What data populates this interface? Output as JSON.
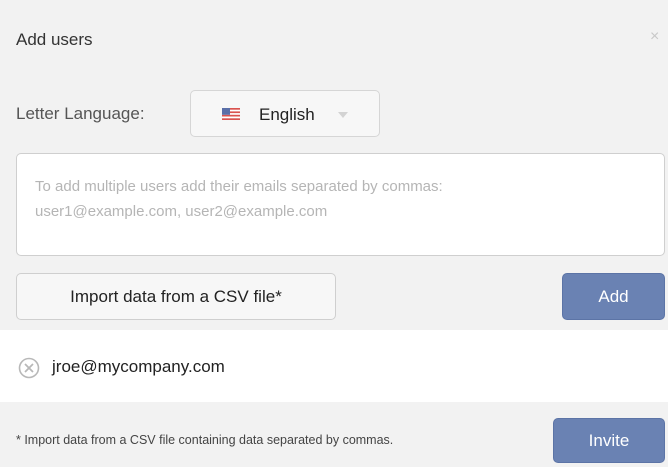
{
  "dialog": {
    "title": "Add users",
    "close_icon": "close-icon",
    "close_glyph": "×"
  },
  "language": {
    "label": "Letter Language:",
    "selected": "English",
    "flag_icon": "us-flag-icon"
  },
  "emails": {
    "placeholder": "To add multiple users add their emails separated by commas:\nuser1@example.com, user2@example.com",
    "value": ""
  },
  "actions": {
    "import_label": "Import data from a CSV file*",
    "add_label": "Add",
    "invite_label": "Invite"
  },
  "users": [
    {
      "email": "jroe@mycompany.com"
    }
  ],
  "footer": {
    "note": "* Import data from a CSV file containing data separated by commas."
  },
  "colors": {
    "primary_button": "#6a82b3",
    "background": "#f2f2f2"
  }
}
